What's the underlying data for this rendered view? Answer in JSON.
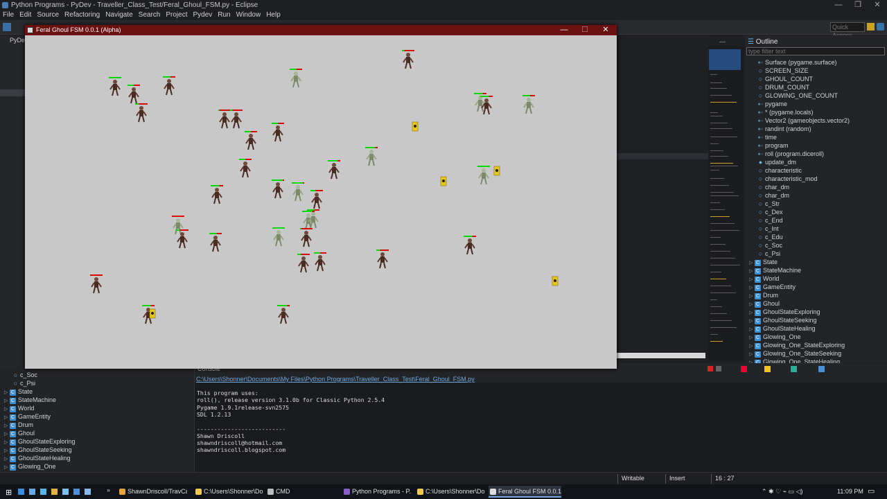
{
  "window": {
    "title": "Python Programs - PyDev - Traveller_Class_Test/Feral_Ghoul_FSM.py - Eclipse",
    "minimize": "—",
    "maximize": "❐",
    "close": "✕"
  },
  "menu": [
    "File",
    "Edit",
    "Source",
    "Refactoring",
    "Navigate",
    "Search",
    "Project",
    "Pydev",
    "Run",
    "Window",
    "Help"
  ],
  "toolbar": {
    "quick_access": "Quick Access"
  },
  "explorer": {
    "tab": "PyDe"
  },
  "game": {
    "title": "Feral Ghoul FSM 0.0.1 (Alpha)",
    "minimize": "—",
    "maximize": "☐",
    "close": "✕",
    "colors": {
      "background": "#c8c8c8",
      "titlebar": "#6b1111",
      "health_full": "#00d800",
      "health_lost": "#e00000",
      "drum": "#e6c619"
    }
  },
  "outline": {
    "tab": "Outline",
    "filter_placeholder": "type filter text",
    "items": [
      {
        "label": "Surface (pygame.surface)",
        "kind": "import"
      },
      {
        "label": "SCREEN_SIZE",
        "kind": "var"
      },
      {
        "label": "GHOUL_COUNT",
        "kind": "var"
      },
      {
        "label": "DRUM_COUNT",
        "kind": "var"
      },
      {
        "label": "GLOWING_ONE_COUNT",
        "kind": "var"
      },
      {
        "label": "pygame",
        "kind": "import"
      },
      {
        "label": "* (pygame.locals)",
        "kind": "import"
      },
      {
        "label": "Vector2 (gameobjects.vector2)",
        "kind": "import"
      },
      {
        "label": "randint (random)",
        "kind": "import"
      },
      {
        "label": "time",
        "kind": "import"
      },
      {
        "label": "program",
        "kind": "import"
      },
      {
        "label": "roll (program.diceroll)",
        "kind": "import"
      },
      {
        "label": "update_dm",
        "kind": "func"
      },
      {
        "label": "characteristic",
        "kind": "var"
      },
      {
        "label": "characteristic_mod",
        "kind": "var"
      },
      {
        "label": "char_dm",
        "kind": "var"
      },
      {
        "label": "char_dm",
        "kind": "var"
      },
      {
        "label": "c_Str",
        "kind": "var"
      },
      {
        "label": "c_Dex",
        "kind": "var"
      },
      {
        "label": "c_End",
        "kind": "var"
      },
      {
        "label": "c_Int",
        "kind": "var"
      },
      {
        "label": "c_Edu",
        "kind": "var"
      },
      {
        "label": "c_Soc",
        "kind": "var"
      },
      {
        "label": "c_Psi",
        "kind": "var"
      },
      {
        "label": "State",
        "kind": "class"
      },
      {
        "label": "StateMachine",
        "kind": "class"
      },
      {
        "label": "World",
        "kind": "class"
      },
      {
        "label": "GameEntity",
        "kind": "class"
      },
      {
        "label": "Drum",
        "kind": "class"
      },
      {
        "label": "Ghoul",
        "kind": "class"
      },
      {
        "label": "GhoulStateExploring",
        "kind": "class"
      },
      {
        "label": "GhoulStateSeeking",
        "kind": "class"
      },
      {
        "label": "GhoulStateHealing",
        "kind": "class"
      },
      {
        "label": "Glowing_One",
        "kind": "class"
      },
      {
        "label": "Glowing_One_StateExploring",
        "kind": "class"
      },
      {
        "label": "Glowing_One_StateSeeking",
        "kind": "class"
      },
      {
        "label": "Glowing_One_StateHealing",
        "kind": "class"
      }
    ]
  },
  "bottom_outline": {
    "items": [
      {
        "label": "c_Soc",
        "kind": "var"
      },
      {
        "label": "c_Psi",
        "kind": "var"
      },
      {
        "label": "State",
        "kind": "class"
      },
      {
        "label": "StateMachine",
        "kind": "class"
      },
      {
        "label": "World",
        "kind": "class"
      },
      {
        "label": "GameEntity",
        "kind": "class"
      },
      {
        "label": "Drum",
        "kind": "class"
      },
      {
        "label": "Ghoul",
        "kind": "class"
      },
      {
        "label": "GhoulStateExploring",
        "kind": "class"
      },
      {
        "label": "GhoulStateSeeking",
        "kind": "class"
      },
      {
        "label": "GhoulStateHealing",
        "kind": "class"
      },
      {
        "label": "Glowing_One",
        "kind": "class"
      }
    ]
  },
  "console": {
    "tab": "Console",
    "path": "C:\\Users\\Shonner\\Documents\\My Files\\Python Programs\\Traveller_Class_Test\\Feral_Ghoul_FSM.py",
    "lines": [
      "This program uses:",
      "roll(), release version 3.1.0b for Classic Python 2.5.4",
      "Pygame 1.9.1release-svn2575",
      "SDL 1.2.13",
      "",
      "--------------------------",
      "Shawn Driscoll",
      "shawndriscoll@hotmail.com",
      "shawndriscoll.blogspot.com"
    ]
  },
  "status": {
    "writable": "Writable",
    "mode": "Insert",
    "position": "16 : 27"
  },
  "taskbar": {
    "items": [
      {
        "label": "ShawnDriscoll/TravCa...",
        "color": "#e8a33d"
      },
      {
        "label": "C:\\Users\\Shonner\\Do...",
        "color": "#f2c94c"
      },
      {
        "label": "CMD",
        "color": "#bbbbbb"
      },
      {
        "label": "Python Programs - P...",
        "color": "#8a5ec7"
      },
      {
        "label": "C:\\Users\\Shonner\\Do...",
        "color": "#f2c94c"
      },
      {
        "label": "Feral Ghoul FSM 0.0.1...",
        "color": "#dddddd"
      }
    ],
    "clock": "11:09 PM"
  }
}
